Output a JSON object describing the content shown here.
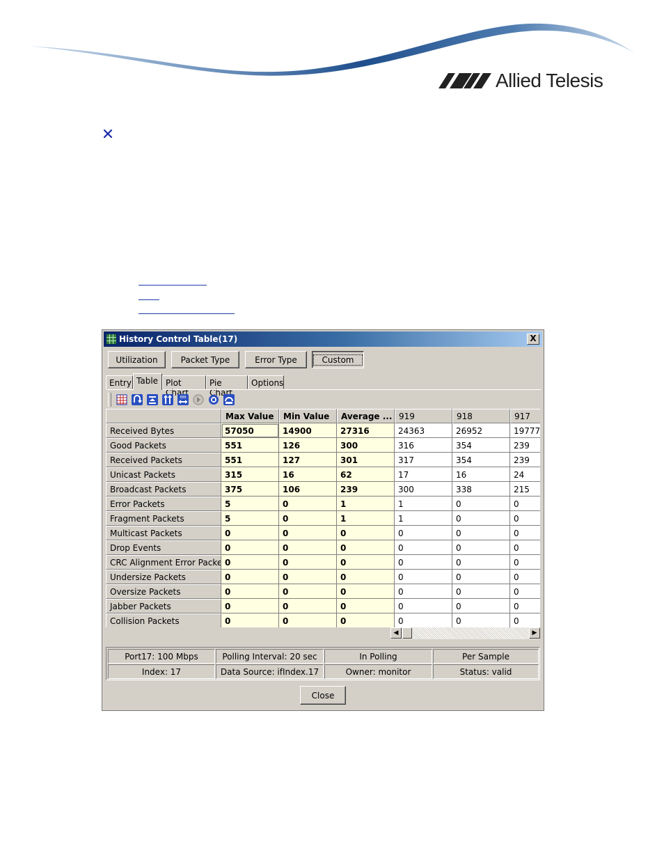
{
  "brand": {
    "name": "Allied Telesis"
  },
  "window": {
    "title": "History Control Table(17)",
    "close_glyph": "X",
    "mode_buttons": [
      "Utilization",
      "Packet Type",
      "Error Type",
      "Custom"
    ],
    "tabs": [
      "Entry",
      "Table",
      "Plot Chart",
      "Pie Chart",
      "Options"
    ],
    "active_tab": "Table",
    "toolbar_icons": [
      "table-icon",
      "refresh-icon",
      "move-top-icon",
      "sort-icon",
      "counter-icon",
      "play-icon",
      "stop-icon",
      "export-icon"
    ],
    "table": {
      "columns": [
        "Max Value",
        "Min Value",
        "Average ...",
        "919",
        "918",
        "917"
      ],
      "rows": [
        {
          "label": "Received Bytes",
          "values": [
            "57050",
            "14900",
            "27316",
            "24363",
            "26952",
            "19777"
          ]
        },
        {
          "label": "Good Packets",
          "values": [
            "551",
            "126",
            "300",
            "316",
            "354",
            "239"
          ]
        },
        {
          "label": "Received Packets",
          "values": [
            "551",
            "127",
            "301",
            "317",
            "354",
            "239"
          ]
        },
        {
          "label": "Unicast Packets",
          "values": [
            "315",
            "16",
            "62",
            "17",
            "16",
            "24"
          ]
        },
        {
          "label": "Broadcast Packets",
          "values": [
            "375",
            "106",
            "239",
            "300",
            "338",
            "215"
          ]
        },
        {
          "label": "Error Packets",
          "values": [
            "5",
            "0",
            "1",
            "1",
            "0",
            "0"
          ]
        },
        {
          "label": "Fragment Packets",
          "values": [
            "5",
            "0",
            "1",
            "1",
            "0",
            "0"
          ]
        },
        {
          "label": "Multicast Packets",
          "values": [
            "0",
            "0",
            "0",
            "0",
            "0",
            "0"
          ]
        },
        {
          "label": "Drop Events",
          "values": [
            "0",
            "0",
            "0",
            "0",
            "0",
            "0"
          ]
        },
        {
          "label": "CRC Alignment Error Packets",
          "values": [
            "0",
            "0",
            "0",
            "0",
            "0",
            "0"
          ]
        },
        {
          "label": "Undersize Packets",
          "values": [
            "0",
            "0",
            "0",
            "0",
            "0",
            "0"
          ]
        },
        {
          "label": "Oversize Packets",
          "values": [
            "0",
            "0",
            "0",
            "0",
            "0",
            "0"
          ]
        },
        {
          "label": "Jabber Packets",
          "values": [
            "0",
            "0",
            "0",
            "0",
            "0",
            "0"
          ]
        },
        {
          "label": "Collision Packets",
          "values": [
            "0",
            "0",
            "0",
            "0",
            "0",
            "0"
          ]
        }
      ]
    },
    "status": {
      "port": "Port17: 100 Mbps",
      "polling_interval": "Polling Interval: 20 sec",
      "polling_state": "In Polling",
      "sample_mode": "Per Sample",
      "index": "Index: 17",
      "data_source": "Data Source: ifIndex.17",
      "owner": "Owner: monitor",
      "status": "Status: valid"
    },
    "close_button": "Close"
  },
  "colors": {
    "title_gradient_start": "#0a246a",
    "title_gradient_end": "#a6caf0",
    "window_face": "#d4d0c8",
    "stat_cell_bg": "#ffffe1",
    "brand_swoosh": "#1f4e8c"
  }
}
